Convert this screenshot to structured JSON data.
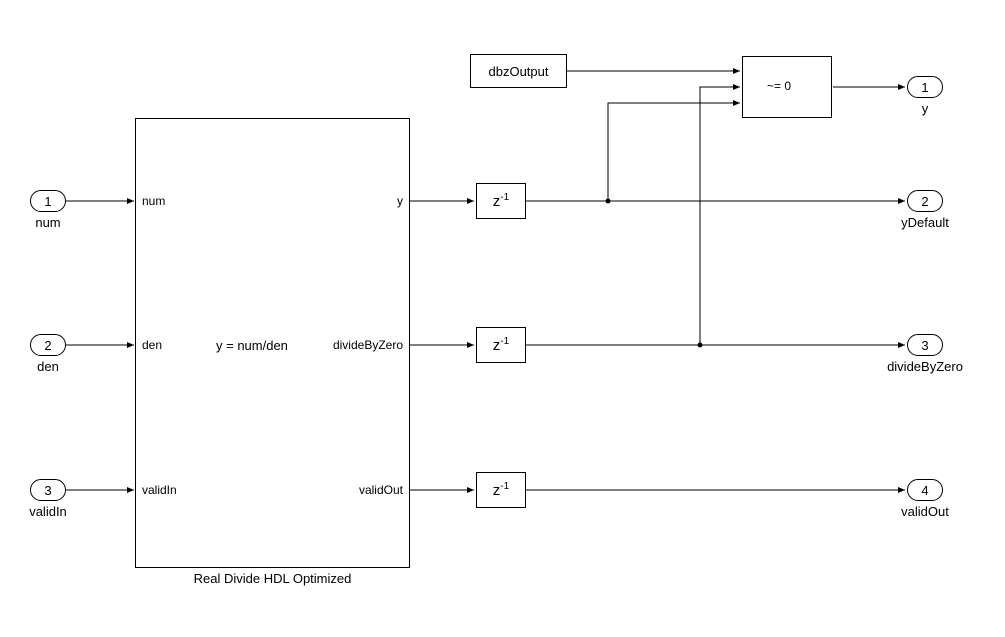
{
  "inports": {
    "num": {
      "number": "1",
      "label": "num"
    },
    "den": {
      "number": "2",
      "label": "den"
    },
    "validIn": {
      "number": "3",
      "label": "validIn"
    }
  },
  "outports": {
    "y": {
      "number": "1",
      "label": "y"
    },
    "yDefault": {
      "number": "2",
      "label": "yDefault"
    },
    "divideByZero": {
      "number": "3",
      "label": "divideByZero"
    },
    "validOut": {
      "number": "4",
      "label": "validOut"
    }
  },
  "mainBlock": {
    "name": "Real Divide HDL Optimized",
    "inLabels": {
      "num": "num",
      "den": "den",
      "validIn": "validIn"
    },
    "outLabels": {
      "y": "y",
      "divideByZero": "divideByZero",
      "validOut": "validOut"
    },
    "centerExpr": "y = num/den"
  },
  "constBlock": {
    "label": "dbzOutput"
  },
  "switchBlock": {
    "criteria": "~= 0"
  },
  "delayText": {
    "z": "z",
    "exp": "-1"
  }
}
